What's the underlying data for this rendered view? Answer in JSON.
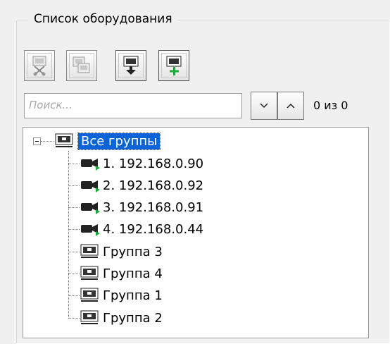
{
  "panel": {
    "title": "Список оборудования"
  },
  "toolbar": {
    "buttons": [
      {
        "name": "remove-device-button",
        "icon": "device-cut-icon",
        "enabled": false
      },
      {
        "name": "copy-device-button",
        "icon": "device-copy-icon",
        "enabled": false
      },
      {
        "name": "import-device-button",
        "icon": "device-download-icon",
        "enabled": true
      },
      {
        "name": "add-device-button",
        "icon": "device-add-icon",
        "enabled": true
      }
    ]
  },
  "search": {
    "placeholder": "Поиск...",
    "counter": "0 из 0"
  },
  "tree": {
    "root": {
      "label": "Все группы",
      "selected": true
    },
    "cameras": [
      {
        "label": "1. 192.168.0.90"
      },
      {
        "label": "2. 192.168.0.92"
      },
      {
        "label": "3. 192.168.0.91"
      },
      {
        "label": "4. 192.168.0.44"
      }
    ],
    "groups": [
      {
        "label": "Группа 3"
      },
      {
        "label": "Группа 4"
      },
      {
        "label": "Группа 1"
      },
      {
        "label": "Группа 2"
      }
    ]
  },
  "colors": {
    "selection": "#0a64d8",
    "status_green": "#1fa83a",
    "background": "#f0f0f0"
  }
}
